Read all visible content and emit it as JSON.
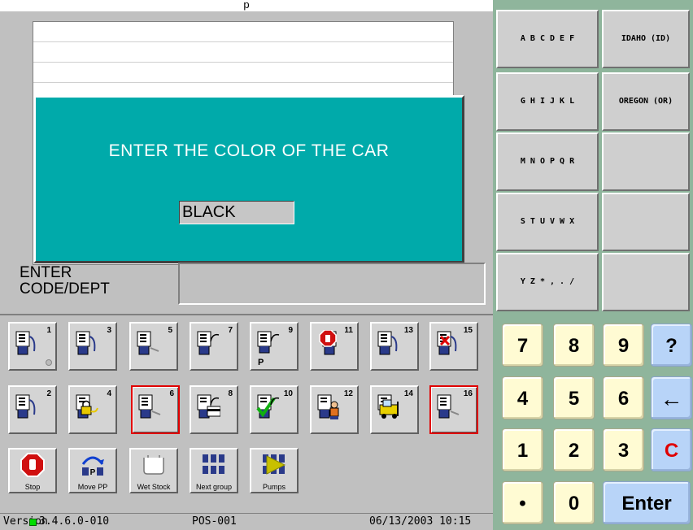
{
  "window": {
    "title": "p"
  },
  "dialog": {
    "prompt": "ENTER THE COLOR OF THE CAR",
    "input_value": "BLACK"
  },
  "code_entry": {
    "label_line1": "ENTER",
    "label_line2": "CODE/DEPT",
    "value": ""
  },
  "keyboard": {
    "rows": [
      {
        "letters": "A B C D E F",
        "state": "IDAHO (ID)"
      },
      {
        "letters": "G H I J K L",
        "state": "OREGON (OR)"
      },
      {
        "letters": "M N O P Q R",
        "state": ""
      },
      {
        "letters": "S T U V W X",
        "state": ""
      },
      {
        "letters": "Y Z * , . /",
        "state": ""
      }
    ]
  },
  "pumps": {
    "top_row": [
      {
        "num": "1",
        "icon": "fuel-pump-idle-icon",
        "selected": false
      },
      {
        "num": "3",
        "icon": "fuel-pump-idle-icon",
        "selected": false
      },
      {
        "num": "5",
        "icon": "fuel-pump-idle-icon",
        "selected": false
      },
      {
        "num": "7",
        "icon": "fuel-pump-nozzle-out-icon",
        "selected": false
      },
      {
        "num": "9",
        "icon": "fuel-pump-prepay-icon",
        "selected": false,
        "badge": "P"
      },
      {
        "num": "11",
        "icon": "fuel-pump-stopped-icon",
        "selected": false
      },
      {
        "num": "13",
        "icon": "fuel-pump-idle-icon",
        "selected": false
      },
      {
        "num": "15",
        "icon": "fuel-pump-error-icon",
        "selected": false
      }
    ],
    "bottom_row": [
      {
        "num": "2",
        "icon": "fuel-pump-idle-icon",
        "selected": false
      },
      {
        "num": "4",
        "icon": "fuel-pump-locked-icon",
        "selected": false
      },
      {
        "num": "6",
        "icon": "fuel-pump-idle-icon",
        "selected": true
      },
      {
        "num": "8",
        "icon": "fuel-pump-card-icon",
        "selected": false
      },
      {
        "num": "10",
        "icon": "fuel-pump-approved-icon",
        "selected": false
      },
      {
        "num": "12",
        "icon": "fuel-pump-attendant-icon",
        "selected": false
      },
      {
        "num": "14",
        "icon": "fuel-pump-forklift-icon",
        "selected": false
      },
      {
        "num": "16",
        "icon": "fuel-pump-idle-icon",
        "selected": true
      }
    ]
  },
  "functions": [
    {
      "label": "Stop",
      "icon": "stop-hand-icon"
    },
    {
      "label": "Move PP",
      "icon": "move-prepay-icon"
    },
    {
      "label": "Wet Stock",
      "icon": "wet-stock-tank-icon"
    },
    {
      "label": "Next group",
      "icon": "next-group-icon"
    },
    {
      "label": "Pumps",
      "icon": "pumps-play-icon"
    }
  ],
  "numpad": {
    "keys": [
      [
        "7",
        "8",
        "9",
        "?"
      ],
      [
        "4",
        "5",
        "6",
        "←"
      ],
      [
        "1",
        "2",
        "3",
        "C"
      ],
      [
        "•",
        "0",
        "Enter"
      ]
    ]
  },
  "status": {
    "version_prefix": "Version",
    "version": "3.4.6.0-010",
    "terminal": "POS-001",
    "datetime": "06/13/2003 10:15"
  },
  "colors": {
    "dialog": "#00aaaa",
    "accent_red": "#e00000",
    "right_panel": "#8fb59c",
    "numpad_key": "#fffbd3",
    "numpad_blue": "#b8d4f8"
  }
}
